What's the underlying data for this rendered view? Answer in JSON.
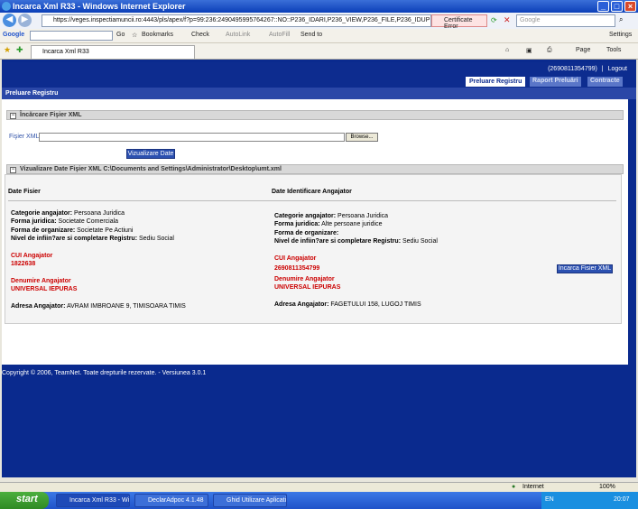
{
  "window": {
    "title": "Incarca Xml R33 - Windows Internet Explorer"
  },
  "address": {
    "url": "https://veges.inspectiamuncii.ro:4443/pls/apex/f?p=99:236:2490495995764267::NO::P236_IDARI,P236_VIEW,P236_FILE,P236_IDUP:10000000002006",
    "cert_error": "Certificate Error",
    "search_placeholder": "Google"
  },
  "google_toolbar": {
    "logo": "Google",
    "go": "Go",
    "bookmarks": "Bookmarks",
    "check": "Check",
    "autolink": "AutoLink",
    "autofill": "AutoFill",
    "send_to": "Send to",
    "settings": "Settings"
  },
  "browser_tab": {
    "label": "Incarca Xml R33"
  },
  "ie_commands": {
    "page": "Page",
    "tools": "Tools"
  },
  "app": {
    "user_id": "(2690811354799)",
    "logout": "Logout",
    "tabs": [
      "Preluare Registru",
      "Raport Preluări",
      "Contracte"
    ],
    "section_title": "Preluare Registru",
    "panel1": {
      "title": "Încărcare Fişier XML",
      "file_label": "Fişier XML",
      "browse": "Browse...",
      "view_button": "Vizualizare Date"
    },
    "panel2": {
      "title": "Vizualizare Date Fişier XML C:\\Documents and Settings\\Administrator\\Desktop\\umt.xml",
      "left_header": "Date Fisier",
      "right_header": "Date Identificare Angajator",
      "categorie_label": "Categorie angajator:",
      "forma_juridica_label": "Forma juridica:",
      "forma_org_label": "Forma de organizare:",
      "nivel_label": "Nivel de infiin?are si completare Registru:",
      "cui_label": "CUI Angajator",
      "denumire_label": "Denumire Angajator",
      "adresa_label": "Adresa Angajator:",
      "left": {
        "categorie": "Persoana Juridica",
        "forma_juridica": "Societate Comerciala",
        "forma_org": "Societate Pe Actiuni",
        "nivel": "Sediu Social",
        "cui": "1822638",
        "denumire": "UNIVERSAL IEPURAS",
        "adresa": "AVRAM IMBROANE 9, TIMISOARA TIMIS"
      },
      "right": {
        "categorie": "Persoana Juridica",
        "forma_juridica": "Alte persoane juridice",
        "forma_org": "",
        "nivel": "Sediu Social",
        "cui": "2690811354799",
        "denumire": "UNIVERSAL IEPURAS",
        "adresa": "FAGETULUI 158, LUGOJ TIMIS"
      },
      "load_button": "Incarca Fisier XML"
    },
    "footer": "Copyright © 2006, TeamNet. Toate drepturile rezervate.  -  Versiunea 3.0.1"
  },
  "statusbar": {
    "zone": "Internet",
    "zoom": "100%"
  },
  "taskbar": {
    "start": "start",
    "items": [
      "Incarca Xml R33 - Wi...",
      "DeclarAdpoc 4.1.48",
      "Ghid Utilizare Aplicati..."
    ],
    "lang": "EN",
    "clock": "20:07"
  }
}
